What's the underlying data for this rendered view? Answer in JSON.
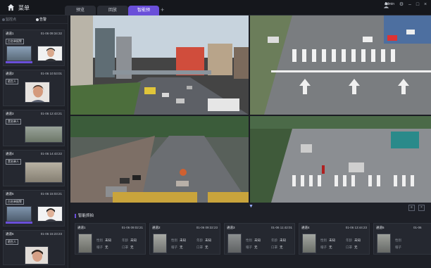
{
  "app": {
    "title": "菜单",
    "user": "Admin"
  },
  "tabs": [
    {
      "label": "预览",
      "active": false
    },
    {
      "label": "回放",
      "active": false
    },
    {
      "label": "智能预览",
      "active": true
    }
  ],
  "left_panel": {
    "tabs": [
      {
        "label": "监控点",
        "active": false
      },
      {
        "label": "告警",
        "active": true
      }
    ],
    "cards": [
      {
        "channel": "通道1",
        "time": "01-06 09:34:32",
        "badge": "白名单报警"
      },
      {
        "channel": "通道2",
        "time": "01-06 10:53:01",
        "badge": "陌生人"
      },
      {
        "channel": "通道3",
        "time": "01-06 12:43:21",
        "badge": "黑名单人"
      },
      {
        "channel": "通道4",
        "time": "01-06 14:43:22",
        "badge": "黑名单人"
      },
      {
        "channel": "通道5",
        "time": "01-06 15:03:21",
        "badge": "白名单报警"
      },
      {
        "channel": "通道6",
        "time": "01-06 15:23:23",
        "badge": "陌生人"
      }
    ]
  },
  "bottom": {
    "title": "智能抓拍",
    "captures": [
      {
        "channel": "通道1",
        "time": "01-06 09:02:21",
        "f1": "性别",
        "v1": "未知",
        "f2": "年龄",
        "v2": "未知",
        "f3": "帽子",
        "v3": "无",
        "f4": "口罩",
        "v4": "无"
      },
      {
        "channel": "通道2",
        "time": "01-06 09:32:23",
        "f1": "性别",
        "v1": "未知",
        "f2": "年龄",
        "v2": "未知",
        "f3": "帽子",
        "v3": "无",
        "f4": "口罩",
        "v4": "无"
      },
      {
        "channel": "通道3",
        "time": "01-06 11:42:01",
        "f1": "性别",
        "v1": "未知",
        "f2": "年龄",
        "v2": "未知",
        "f3": "帽子",
        "v3": "无",
        "f4": "口罩",
        "v4": "无"
      },
      {
        "channel": "通道4",
        "time": "01-06 13:44:23",
        "f1": "性别",
        "v1": "未知",
        "f2": "年龄",
        "v2": "未知",
        "f3": "帽子",
        "v3": "无",
        "f4": "口罩",
        "v4": "无"
      },
      {
        "channel": "通道5",
        "time": "01-06",
        "f1": "性别",
        "v1": "",
        "f2": "",
        "v2": "",
        "f3": "帽子",
        "v3": "",
        "f4": "",
        "v4": ""
      }
    ]
  },
  "colors": {
    "accent": "#6a4fd9",
    "background": "#1b1d23",
    "panel": "#1e2027"
  }
}
